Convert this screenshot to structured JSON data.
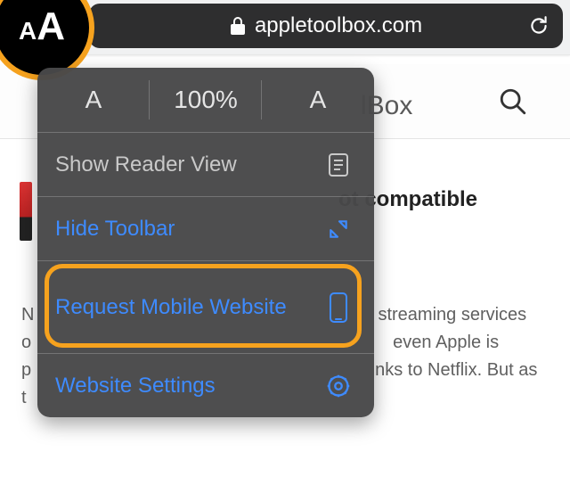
{
  "address_bar": {
    "domain": "appletoolbox.com",
    "aa_small": "A",
    "aa_large": "A"
  },
  "nav": {
    "visible_title_fragment": "lBox"
  },
  "article": {
    "headline_fragment": "ot compatible",
    "body_line1": "N",
    "body_line1b": "streaming services",
    "body_line2": "o",
    "body_line2b": "even Apple is",
    "body_line3": "p",
    "body_line3b": "nks to Netflix. But as",
    "body_line4": "t"
  },
  "popover": {
    "font_small": "A",
    "zoom": "100%",
    "font_large": "A",
    "reader": "Show Reader View",
    "hide_toolbar": "Hide Toolbar",
    "request_mobile": "Request Mobile Website",
    "website_settings": "Website Settings"
  },
  "colors": {
    "highlight": "#f6a21e",
    "link": "#3e8bff"
  }
}
